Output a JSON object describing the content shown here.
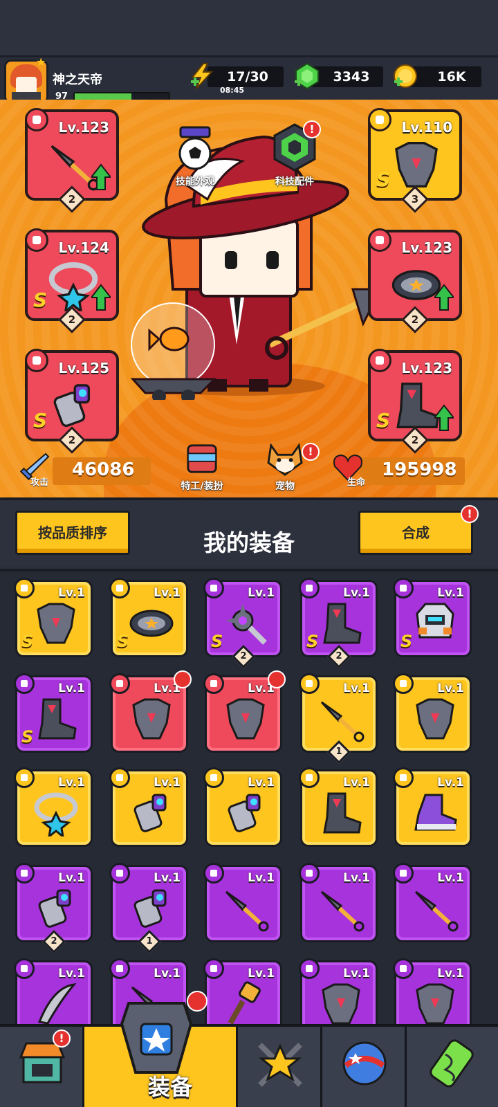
{
  "player": {
    "name": "神之天帝",
    "level": "97",
    "xp_fraction": 0.6
  },
  "resources": {
    "energy": "17/30",
    "energy_timer": "08:45",
    "gems": "3343",
    "coins": "16K"
  },
  "hero": {
    "left_slots": [
      {
        "level": "Lv.123",
        "count": "2",
        "rarity": "red",
        "s_mark": "",
        "upgrade": true,
        "icon": "kunai-icon"
      },
      {
        "level": "Lv.124",
        "count": "2",
        "rarity": "red",
        "s_mark": "S",
        "upgrade": true,
        "icon": "necklace-icon"
      },
      {
        "level": "Lv.125",
        "count": "2",
        "rarity": "red",
        "s_mark": "S",
        "upgrade": false,
        "icon": "gauntlet-icon"
      }
    ],
    "right_slots": [
      {
        "level": "Lv.110",
        "count": "3",
        "rarity": "gold",
        "s_mark": "S",
        "upgrade": false,
        "icon": "armor-icon"
      },
      {
        "level": "Lv.123",
        "count": "2",
        "rarity": "red",
        "s_mark": "",
        "upgrade": true,
        "icon": "belt-icon"
      },
      {
        "level": "Lv.123",
        "count": "2",
        "rarity": "red",
        "s_mark": "S",
        "upgrade": true,
        "icon": "boots-icon"
      }
    ],
    "skill_skin_label": "技能外观",
    "tech_parts_label": "科技配件",
    "agent_label": "特工/装扮",
    "pet_label": "宠物",
    "attack_label": "攻击",
    "attack_value": "46086",
    "hp_label": "生命",
    "hp_value": "195998",
    "alert_mark": "!"
  },
  "equipment": {
    "sort_label": "按品质排序",
    "title": "我的装备",
    "merge_label": "合成",
    "items": [
      {
        "rarity": "gold",
        "level": "Lv.1",
        "s_mark": "S",
        "count": "",
        "icon": "armor-icon"
      },
      {
        "rarity": "gold",
        "level": "Lv.1",
        "s_mark": "S",
        "count": "",
        "icon": "belt-icon"
      },
      {
        "rarity": "purple",
        "level": "Lv.1",
        "s_mark": "S",
        "count": "2",
        "icon": "spiked-weapon-icon"
      },
      {
        "rarity": "purple",
        "level": "Lv.1",
        "s_mark": "S",
        "count": "2",
        "icon": "boots-icon"
      },
      {
        "rarity": "purple",
        "level": "Lv.1",
        "s_mark": "S",
        "count": "",
        "icon": "robot-armor-icon"
      },
      {
        "rarity": "purple",
        "level": "Lv.1",
        "s_mark": "S",
        "count": "",
        "icon": "boots-icon"
      },
      {
        "rarity": "red",
        "level": "Lv.1",
        "s_mark": "",
        "count": "",
        "icon": "armor-icon",
        "new": true
      },
      {
        "rarity": "red",
        "level": "Lv.1",
        "s_mark": "",
        "count": "",
        "icon": "armor-icon",
        "new": true
      },
      {
        "rarity": "gold",
        "level": "Lv.1",
        "s_mark": "",
        "count": "1",
        "icon": "kunai-icon"
      },
      {
        "rarity": "gold",
        "level": "Lv.1",
        "s_mark": "",
        "count": "",
        "icon": "armor-icon"
      },
      {
        "rarity": "gold",
        "level": "Lv.1",
        "s_mark": "",
        "count": "",
        "icon": "necklace-icon"
      },
      {
        "rarity": "gold",
        "level": "Lv.1",
        "s_mark": "",
        "count": "",
        "icon": "gauntlet-icon"
      },
      {
        "rarity": "gold",
        "level": "Lv.1",
        "s_mark": "",
        "count": "",
        "icon": "gauntlet-icon"
      },
      {
        "rarity": "gold",
        "level": "Lv.1",
        "s_mark": "",
        "count": "",
        "icon": "boots-icon"
      },
      {
        "rarity": "gold",
        "level": "Lv.1",
        "s_mark": "",
        "count": "",
        "icon": "sneaker-icon"
      },
      {
        "rarity": "purple",
        "level": "Lv.1",
        "s_mark": "",
        "count": "2",
        "icon": "gauntlet-icon"
      },
      {
        "rarity": "purple",
        "level": "Lv.1",
        "s_mark": "",
        "count": "1",
        "icon": "gauntlet-icon"
      },
      {
        "rarity": "purple",
        "level": "Lv.1",
        "s_mark": "",
        "count": "",
        "icon": "kunai-icon"
      },
      {
        "rarity": "purple",
        "level": "Lv.1",
        "s_mark": "",
        "count": "",
        "icon": "kunai-icon"
      },
      {
        "rarity": "purple",
        "level": "Lv.1",
        "s_mark": "",
        "count": "",
        "icon": "kunai-icon"
      },
      {
        "rarity": "purple",
        "level": "Lv.1",
        "s_mark": "",
        "count": "",
        "icon": "blade-icon"
      },
      {
        "rarity": "purple",
        "level": "Lv.1",
        "s_mark": "",
        "count": "",
        "icon": "kunai-icon"
      },
      {
        "rarity": "purple",
        "level": "Lv.1",
        "s_mark": "",
        "count": "",
        "icon": "hammer-icon"
      },
      {
        "rarity": "purple",
        "level": "Lv.1",
        "s_mark": "",
        "count": "",
        "icon": "armor-icon"
      },
      {
        "rarity": "purple",
        "level": "Lv.1",
        "s_mark": "",
        "count": "",
        "icon": "armor-icon"
      }
    ]
  },
  "nav": {
    "active_label": "装备",
    "tabs": [
      "shop-icon",
      "equipment-icon",
      "star-swords-icon",
      "planet-icon",
      "dna-capsule-icon"
    ]
  }
}
